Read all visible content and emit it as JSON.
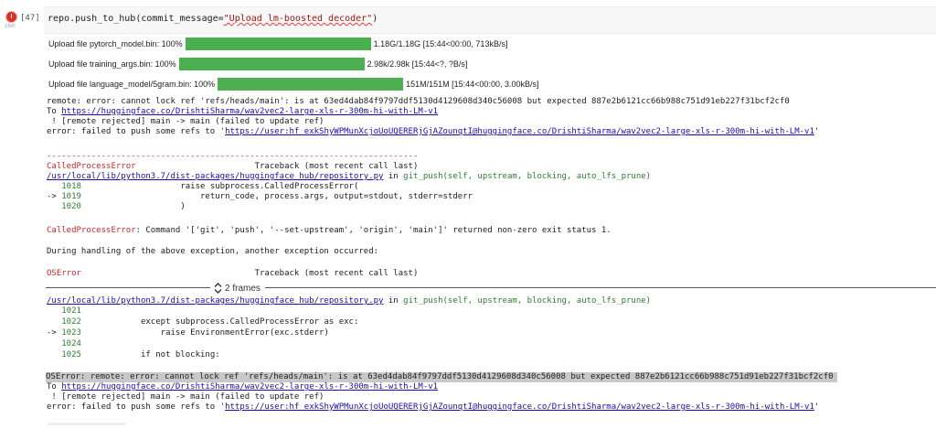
{
  "cell": {
    "execution_count": "[47]",
    "run_time": "16m",
    "code": {
      "pre": "repo.push_to_hub(commit_message=",
      "string": "\"Upload lm-boosted decoder\"",
      "post": ")"
    }
  },
  "uploads": [
    {
      "label": "Upload file pytorch_model.bin: 100%",
      "progress": 100,
      "stats": "1.18G/1.18G [15:44<00:00, 713kB/s]"
    },
    {
      "label": "Upload file training_args.bin: 100%",
      "progress": 100,
      "stats": "2.98k/2.98k [15:44<?, ?B/s]"
    },
    {
      "label": "Upload file language_model/5gram.bin: 100%",
      "progress": 100,
      "stats": "151M/151M [15:44<00:00, 3.00kB/s]"
    }
  ],
  "colors": {
    "progress": "#4caf50",
    "error_dot": "#d93025",
    "link": "#1a0dab",
    "exception": "#c62828"
  },
  "error1": {
    "line1": "remote: error: cannot lock ref 'refs/heads/main': is at 63ed4dab84f9797ddf5130d4129608d340c56008 but expected 887e2b6121cc66b988c751d91eb227f31bcf2cf0",
    "line2_prefix": "To ",
    "line2_link": "https://huggingface.co/DrishtiSharma/wav2vec2-large-xls-r-300m-hi-with-LM-v1",
    "line3": " ! [remote rejected] main -> main (failed to update ref)",
    "line4_prefix": "error: failed to push some refs to '",
    "line4_link": "https://user: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@huggingface.co/DrishtiSharma/wav2vec2-large-xls-r-300m-hi-with-LM-v1",
    "line4_suffix": "'"
  },
  "traceback1": {
    "separator": "---------------------------------------------------------------------------",
    "exc_name": "CalledProcessError",
    "header_right": "                        Traceback (most recent call last)",
    "file": "/usr/local/lib/python3.7/dist-packages/huggingface_hub/repository.py",
    "in_text": " in ",
    "func": "git_push(self, upstream, blocking, auto_lfs_prune)",
    "code_lines": [
      {
        "marker": "   ",
        "num": "1018",
        "text": "                    raise subprocess.CalledProcessError("
      },
      {
        "marker": "-> ",
        "num": "1019",
        "text": "                        return_code, process.args, output=stdout, stderr=stderr"
      },
      {
        "marker": "   ",
        "num": "1020",
        "text": "                    )"
      }
    ],
    "message_name": "CalledProcessError",
    "message_text": ": Command '['git', 'push', '--set-upstream', 'origin', 'main']' returned non-zero exit status 1."
  },
  "during_text": "During handling of the above exception, another exception occurred:",
  "traceback2": {
    "exc_name": "OSError",
    "header_right": "                                   Traceback (most recent call last)",
    "frames_label": "2 frames",
    "file": "/usr/local/lib/python3.7/dist-packages/huggingface_hub/repository.py",
    "in_text": " in ",
    "func": "git_push(self, upstream, blocking, auto_lfs_prune)",
    "code_lines": [
      {
        "marker": "   ",
        "num": "1021",
        "text": ""
      },
      {
        "marker": "   ",
        "num": "1022",
        "text": "            except subprocess.CalledProcessError as exc:"
      },
      {
        "marker": "-> ",
        "num": "1023",
        "text": "                raise EnvironmentError(exc.stderr)"
      },
      {
        "marker": "   ",
        "num": "1024",
        "text": ""
      },
      {
        "marker": "   ",
        "num": "1025",
        "text": "            if not blocking:"
      }
    ]
  },
  "error2": {
    "line1": "OSError: remote: error: cannot lock ref 'refs/heads/main': is at 63ed4dab84f9797ddf5130d4129608d340c56008 but expected 887e2b6121cc66b988c751d91eb227f31bcf2cf0",
    "line2_prefix": "To ",
    "line2_link": "https://huggingface.co/DrishtiSharma/wav2vec2-large-xls-r-300m-hi-with-LM-v1",
    "line3": " ! [remote rejected] main -> main (failed to update ref)",
    "line4_prefix": "error: failed to push some refs to '",
    "line4_link": "https://user: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@huggingface.co/DrishtiSharma/wav2vec2-large-xls-r-300m-hi-with-LM-v1",
    "line4_suffix": "'"
  }
}
